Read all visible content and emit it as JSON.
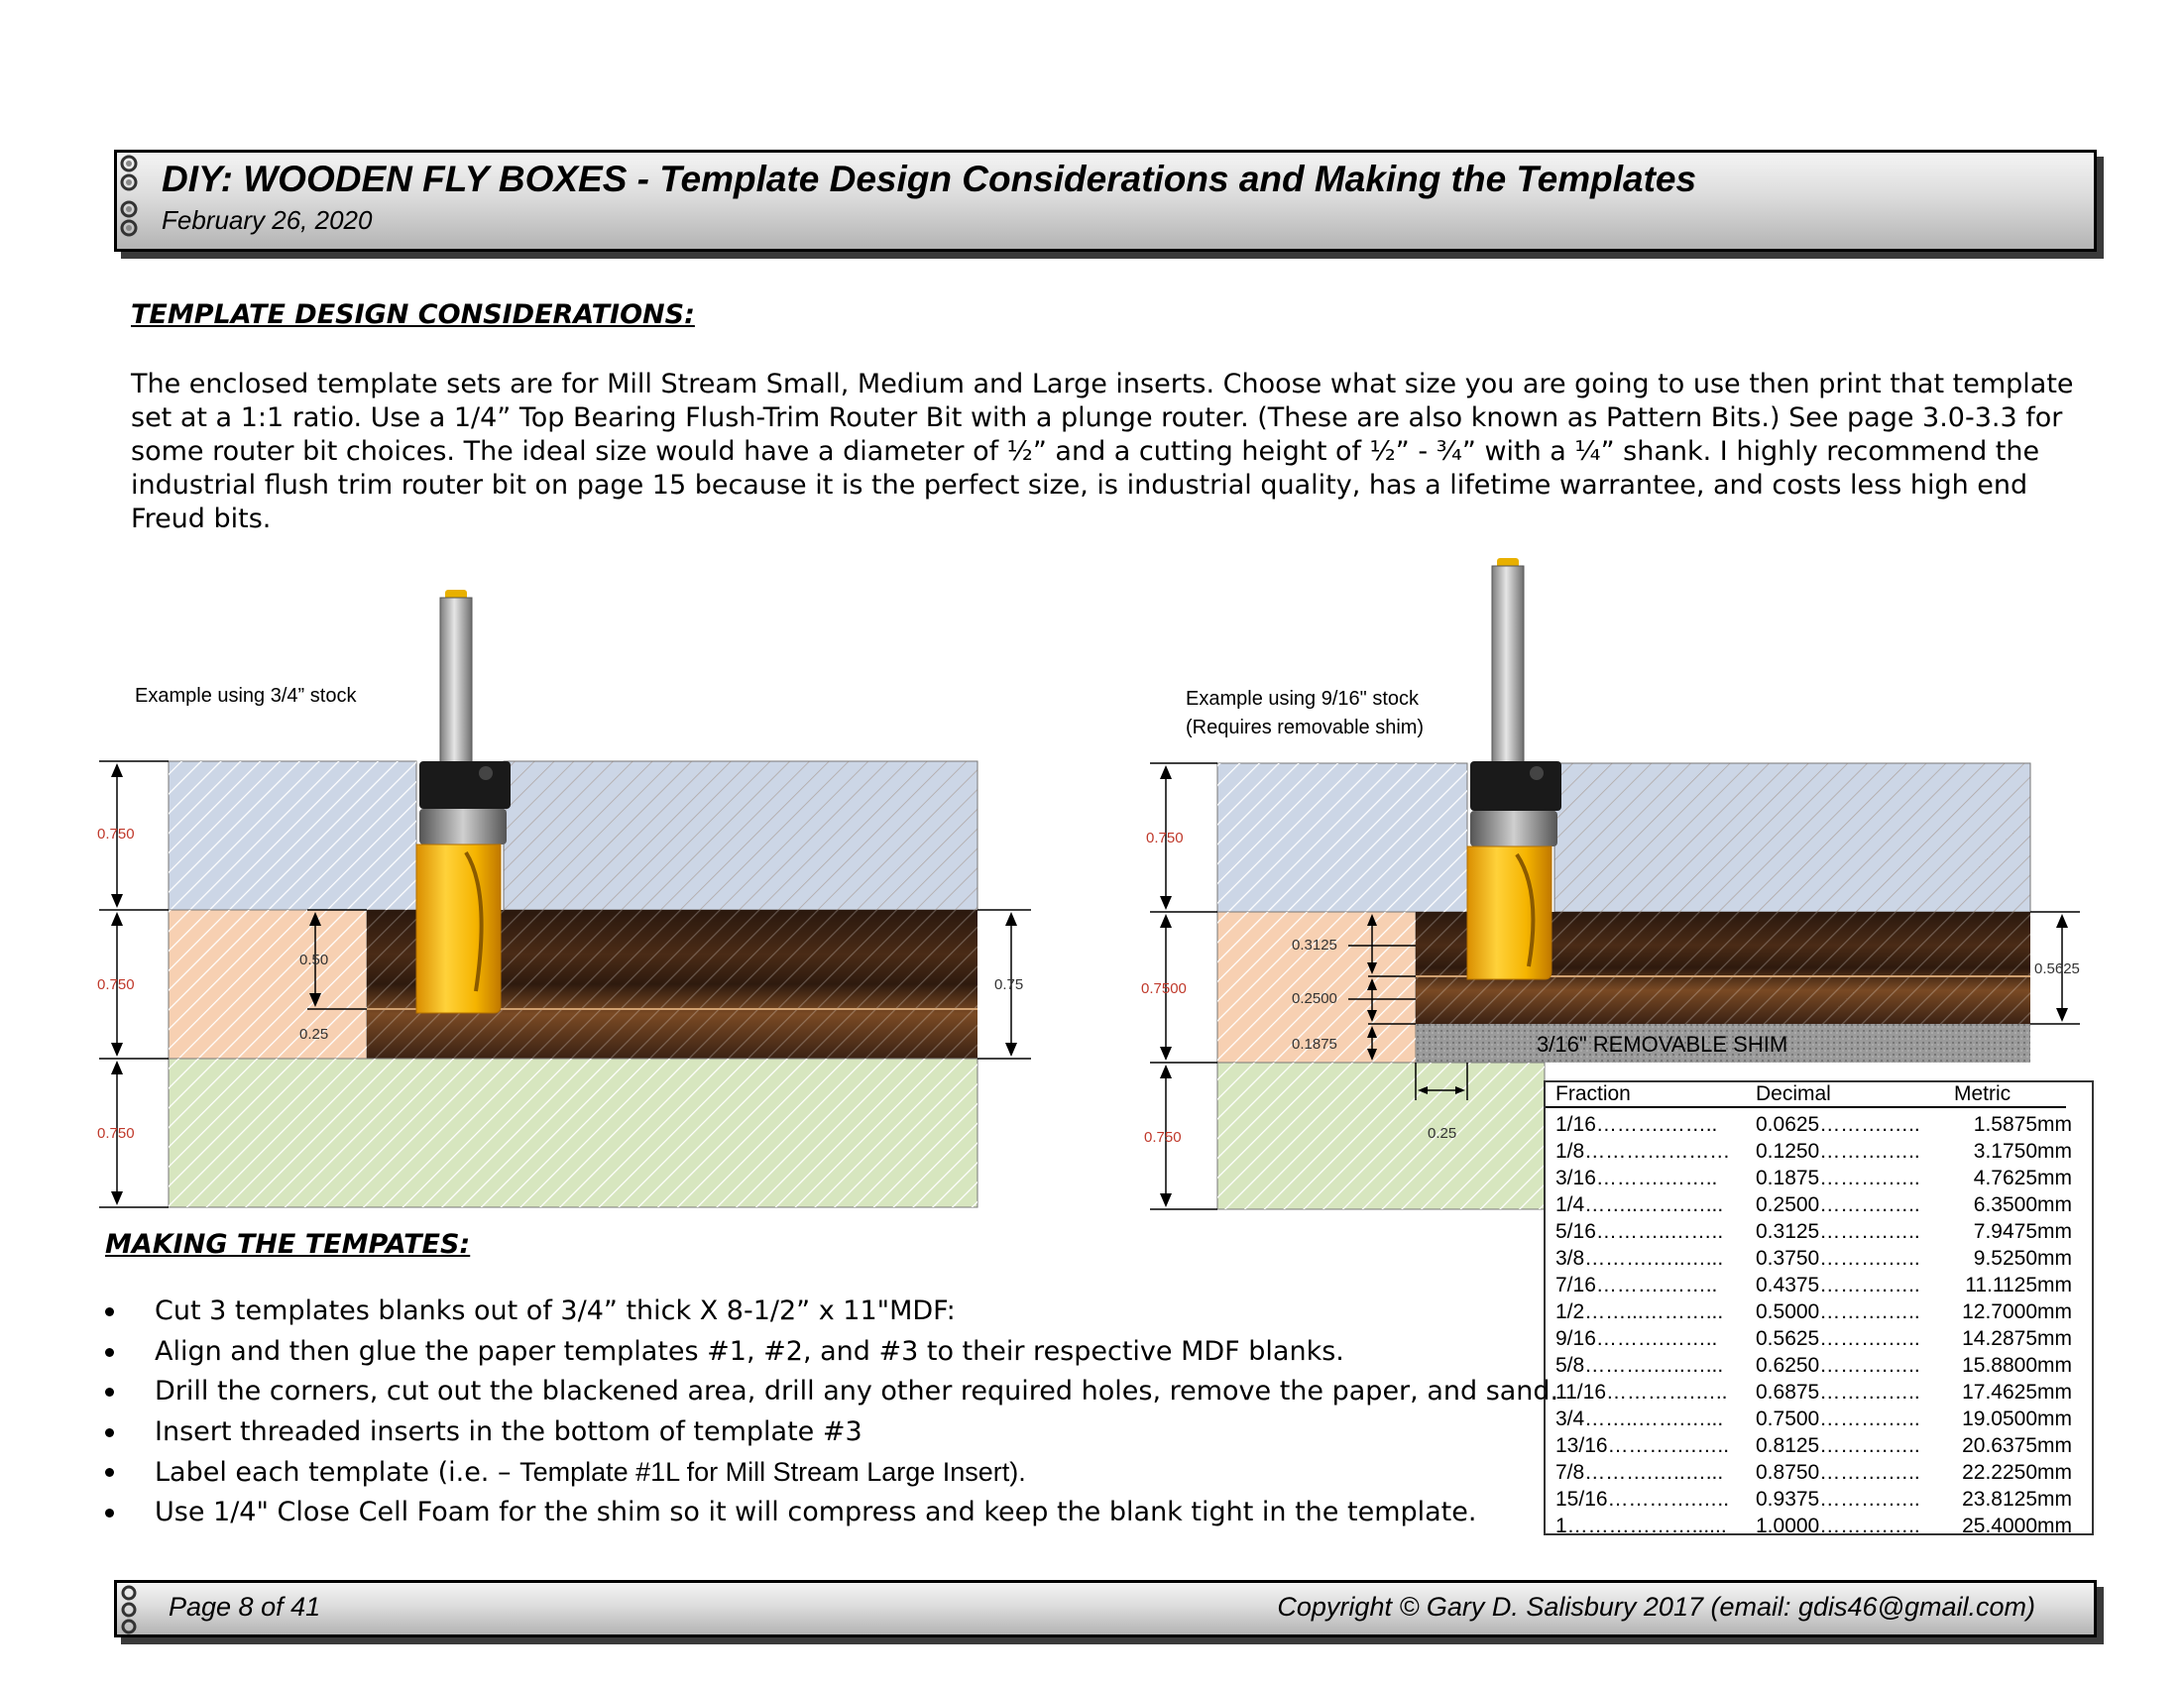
{
  "header": {
    "title": "DIY: WOODEN FLY BOXES - Template Design Considerations and Making the Templates",
    "date": "February 26, 2020"
  },
  "section_design": {
    "heading": "TEMPLATE DESIGN CONSIDERATIONS:",
    "paragraph": "The enclosed template sets are for  Mill Stream Small, Medium and Large inserts.  Choose what size you are going to use then print that template set at a 1:1 ratio. Use a 1/4” Top Bearing Flush-Trim Router Bit with a  plunge router. (These are also known as Pattern Bits.) See page 3.0-3.3 for some router bit choices.  The ideal size would have a diameter of ½” and a cutting height of ½” - ¾” with a ¼” shank.  I highly recommend the industrial flush trim router bit on page 15 because it is the perfect size, is industrial quality, has a lifetime warrantee, and costs less high end Freud bits."
  },
  "diagram_left": {
    "caption": "Example using 3/4” stock",
    "dims": {
      "top": "0.750",
      "middle": "0.750",
      "bottom": "0.750",
      "cut": "0.50",
      "gap": "0.25",
      "right": "0.75"
    }
  },
  "diagram_right": {
    "caption_line1": "Example using 9/16\" stock",
    "caption_line2": "(Requires removable shim)",
    "dims": {
      "top": "0.750",
      "middle": "0.7500",
      "bottom": "0.750",
      "a": "0.3125",
      "b": "0.2500",
      "c": "0.1875",
      "gap": "0.25",
      "right": "0.5625"
    },
    "shim_label": "3/16\" REMOVABLE SHIM"
  },
  "conversion_table": {
    "headers": [
      "Fraction",
      "Decimal",
      "Metric"
    ],
    "rows": [
      [
        "1/16……….……..",
        "0.0625……….…..",
        "1.5875mm"
      ],
      [
        "1/8…………………",
        "0.1250……….…..",
        "3.1750mm"
      ],
      [
        "3/16……….……..",
        "0.1875……….…..",
        "4.7625mm"
      ],
      [
        "1/4……..…….…...",
        "0.2500……….…..",
        "6.3500mm"
      ],
      [
        "5/16………..……..",
        "0.3125……….…..",
        "7.9475mm"
      ],
      [
        "3/8……….…..…...",
        "0.3750……….…..",
        "9.5250mm"
      ],
      [
        "7/16……….……..",
        "0.4375……….…..",
        "11.1125mm"
      ],
      [
        "1/2……...………...",
        "0.5000……….…..",
        "12.7000mm"
      ],
      [
        "9/16……….……..",
        "0.5625……….…..",
        "14.2875mm"
      ],
      [
        "5/8……….…..…...",
        "0.6250……….…..",
        "15.8800mm"
      ],
      [
        "11/16………….…..",
        "0.6875……….…..",
        "17.4625mm"
      ],
      [
        "3/4……..…….…...",
        "0.7500……….…..",
        "19.0500mm"
      ],
      [
        "13/16………….…..",
        "0.8125……….…..",
        "20.6375mm"
      ],
      [
        "7/8……….…..…...",
        "0.8750……….…..",
        "22.2250mm"
      ],
      [
        "15/16………….…..",
        "0.9375……….…..",
        "23.8125mm"
      ],
      [
        "1………………......",
        "1.0000……….…..",
        "25.4000mm"
      ]
    ]
  },
  "section_making": {
    "heading": "MAKING THE TEMPATES:",
    "bullets": [
      "Cut 3 templates blanks out of 3/4” thick X 8-1/2” x 11\"MDF:",
      "Align and then glue the paper templates #1, #2, and #3 to their respective MDF blanks.",
      "Drill the corners, cut out the blackened area, drill any other required holes, remove the paper, and sand.",
      "Insert threaded inserts in the bottom of template #3",
      "Use 1/4\" Close Cell Foam for the shim so it will compress and keep the blank tight in the template."
    ],
    "bullet_label_prefix": "Label each template (i.e. – ",
    "bullet_label_suffix": "Template #1L for Mill Stream Large Insert)."
  },
  "footer": {
    "page": "Page 8 of 41",
    "copyright": "Copyright © Gary D. Salisbury 2017 (email: gdis46@gmail.com)"
  },
  "colors": {
    "blue_layer": "#ccd6e6",
    "peach_layer": "#f7d0b2",
    "green_layer": "#d7e6bf",
    "wood_dark": "#3b2214",
    "bit_yellow": "#f5b400",
    "dimension_red": "#c0392b"
  }
}
